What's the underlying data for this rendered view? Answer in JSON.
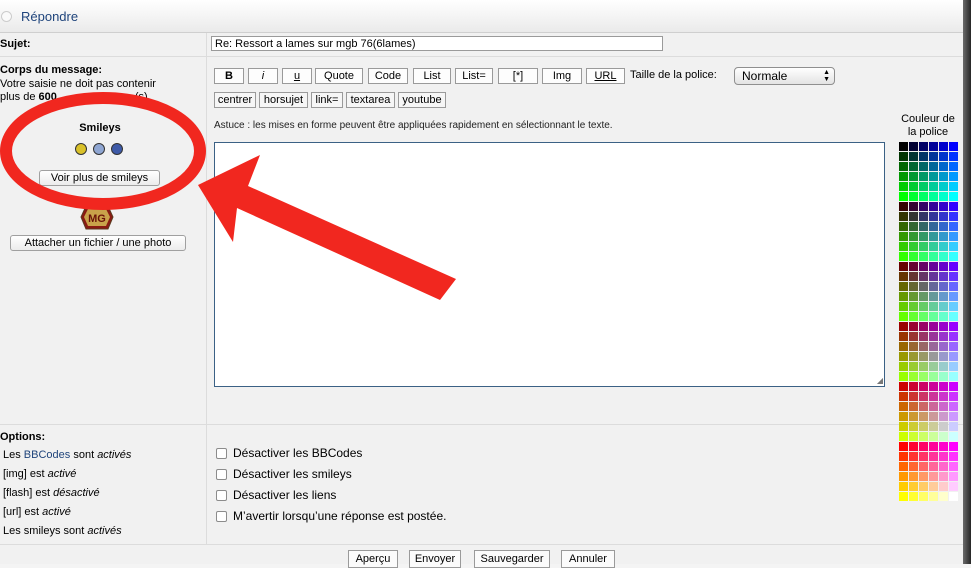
{
  "header": {
    "title": "Répondre"
  },
  "subject": {
    "label": "Sujet:",
    "value": "Re: Ressort a lames sur mgb 76(6lames)"
  },
  "message": {
    "label": "Corps du message:",
    "info_line1": "Votre saisie ne doit pas contenir",
    "info_line2_start": "plus de ",
    "info_line2_bold": "600",
    "info_line2_end": "(s)"
  },
  "toolbar": {
    "row1": [
      "B",
      "i",
      "u",
      "Quote",
      "Code",
      "List",
      "List=",
      "[*]",
      "Img",
      "URL"
    ],
    "size_label": "Taille de la police:",
    "size_value": "Normale",
    "row2": [
      "centrer",
      "horsujet",
      "link=",
      "textarea",
      "youtube"
    ],
    "hint": "Astuce : les mises en forme peuvent être appliquées rapidement en sélectionnant le texte."
  },
  "color_panel": {
    "title_line1": "Couleur de",
    "title_line2": "la police"
  },
  "smileys": {
    "title": "Smileys",
    "more_button": "Voir plus de smileys",
    "attach_button": "Attacher un fichier / une photo",
    "icons": [
      "smile-smiley",
      "cool-smiley",
      "sad-smiley"
    ],
    "colors": [
      "#d9c12a",
      "#8fa6d2",
      "#3e5aa8"
    ]
  },
  "options": {
    "label": "Options:",
    "status": {
      "bbcode_prefix": "Les ",
      "bbcode_link": "BBCodes",
      "bbcode_mid": " sont ",
      "bbcode_state": "activés",
      "img_prefix": "[img] est ",
      "img_state": "activé",
      "flash_prefix": "[flash] est ",
      "flash_state": "désactivé",
      "url_prefix": "[url] est ",
      "url_state": "activé",
      "smileys_prefix": "Les smileys sont ",
      "smileys_state": "activés"
    },
    "checkboxes": [
      "Désactiver les BBCodes",
      "Désactiver les smileys",
      "Désactiver les liens",
      "M’avertir lorsqu’une réponse est postée."
    ]
  },
  "actions": [
    "Aperçu",
    "Envoyer",
    "Sauvegarder",
    "Annuler"
  ],
  "annotation": {
    "shape": "red-circle-and-arrow",
    "color": "#f1271f"
  },
  "colors": {
    "accent": "#20457c",
    "textarea_border": "#3b6185"
  }
}
